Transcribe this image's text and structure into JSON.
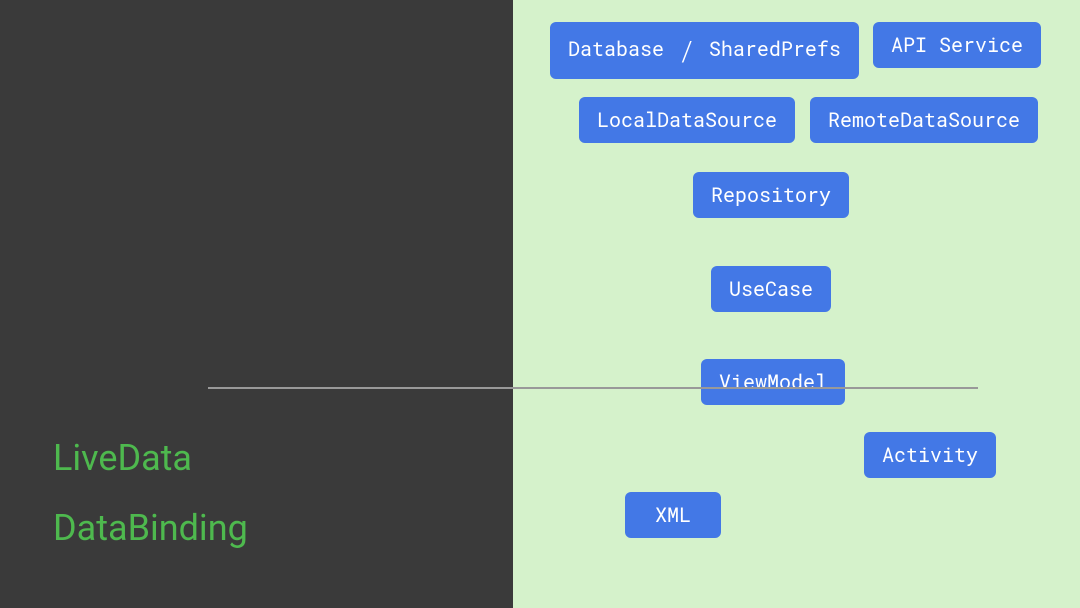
{
  "left": {
    "line1": "LiveData",
    "line2": "DataBinding"
  },
  "nodes": {
    "database_prefs_left": "Database ",
    "database_prefs_slash": "/",
    "database_prefs_right": " SharedPrefs",
    "api_service": "API Service",
    "local_data_source": "LocalDataSource",
    "remote_data_source": "RemoteDataSource",
    "repository": "Repository",
    "usecase": "UseCase",
    "viewmodel": "ViewModel",
    "activity": "Activity",
    "xml": "XML"
  }
}
